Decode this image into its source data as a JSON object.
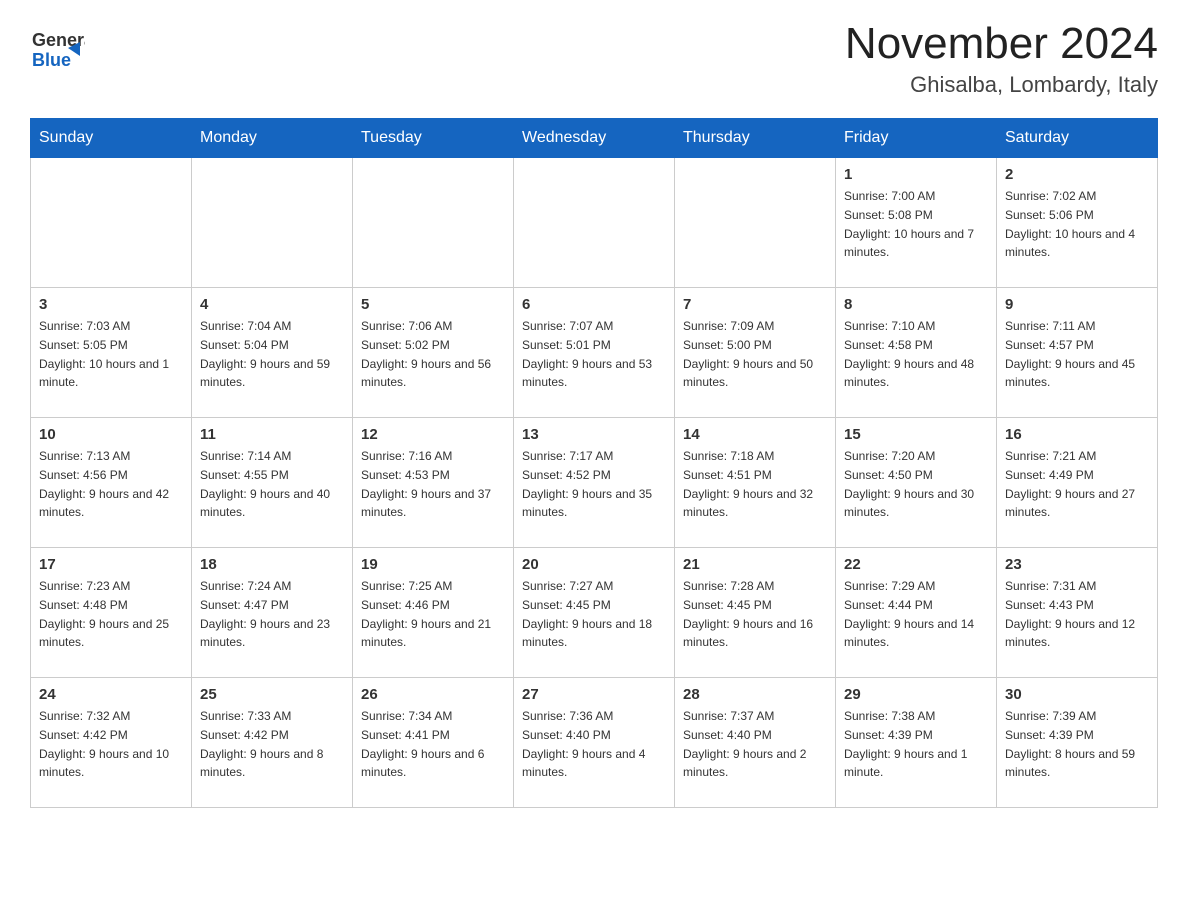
{
  "header": {
    "logo_line1": "General",
    "logo_line2": "Blue",
    "month_title": "November 2024",
    "location": "Ghisalba, Lombardy, Italy"
  },
  "weekdays": [
    "Sunday",
    "Monday",
    "Tuesday",
    "Wednesday",
    "Thursday",
    "Friday",
    "Saturday"
  ],
  "weeks": [
    [
      {
        "day": "",
        "sunrise": "",
        "sunset": "",
        "daylight": ""
      },
      {
        "day": "",
        "sunrise": "",
        "sunset": "",
        "daylight": ""
      },
      {
        "day": "",
        "sunrise": "",
        "sunset": "",
        "daylight": ""
      },
      {
        "day": "",
        "sunrise": "",
        "sunset": "",
        "daylight": ""
      },
      {
        "day": "",
        "sunrise": "",
        "sunset": "",
        "daylight": ""
      },
      {
        "day": "1",
        "sunrise": "Sunrise: 7:00 AM",
        "sunset": "Sunset: 5:08 PM",
        "daylight": "Daylight: 10 hours and 7 minutes."
      },
      {
        "day": "2",
        "sunrise": "Sunrise: 7:02 AM",
        "sunset": "Sunset: 5:06 PM",
        "daylight": "Daylight: 10 hours and 4 minutes."
      }
    ],
    [
      {
        "day": "3",
        "sunrise": "Sunrise: 7:03 AM",
        "sunset": "Sunset: 5:05 PM",
        "daylight": "Daylight: 10 hours and 1 minute."
      },
      {
        "day": "4",
        "sunrise": "Sunrise: 7:04 AM",
        "sunset": "Sunset: 5:04 PM",
        "daylight": "Daylight: 9 hours and 59 minutes."
      },
      {
        "day": "5",
        "sunrise": "Sunrise: 7:06 AM",
        "sunset": "Sunset: 5:02 PM",
        "daylight": "Daylight: 9 hours and 56 minutes."
      },
      {
        "day": "6",
        "sunrise": "Sunrise: 7:07 AM",
        "sunset": "Sunset: 5:01 PM",
        "daylight": "Daylight: 9 hours and 53 minutes."
      },
      {
        "day": "7",
        "sunrise": "Sunrise: 7:09 AM",
        "sunset": "Sunset: 5:00 PM",
        "daylight": "Daylight: 9 hours and 50 minutes."
      },
      {
        "day": "8",
        "sunrise": "Sunrise: 7:10 AM",
        "sunset": "Sunset: 4:58 PM",
        "daylight": "Daylight: 9 hours and 48 minutes."
      },
      {
        "day": "9",
        "sunrise": "Sunrise: 7:11 AM",
        "sunset": "Sunset: 4:57 PM",
        "daylight": "Daylight: 9 hours and 45 minutes."
      }
    ],
    [
      {
        "day": "10",
        "sunrise": "Sunrise: 7:13 AM",
        "sunset": "Sunset: 4:56 PM",
        "daylight": "Daylight: 9 hours and 42 minutes."
      },
      {
        "day": "11",
        "sunrise": "Sunrise: 7:14 AM",
        "sunset": "Sunset: 4:55 PM",
        "daylight": "Daylight: 9 hours and 40 minutes."
      },
      {
        "day": "12",
        "sunrise": "Sunrise: 7:16 AM",
        "sunset": "Sunset: 4:53 PM",
        "daylight": "Daylight: 9 hours and 37 minutes."
      },
      {
        "day": "13",
        "sunrise": "Sunrise: 7:17 AM",
        "sunset": "Sunset: 4:52 PM",
        "daylight": "Daylight: 9 hours and 35 minutes."
      },
      {
        "day": "14",
        "sunrise": "Sunrise: 7:18 AM",
        "sunset": "Sunset: 4:51 PM",
        "daylight": "Daylight: 9 hours and 32 minutes."
      },
      {
        "day": "15",
        "sunrise": "Sunrise: 7:20 AM",
        "sunset": "Sunset: 4:50 PM",
        "daylight": "Daylight: 9 hours and 30 minutes."
      },
      {
        "day": "16",
        "sunrise": "Sunrise: 7:21 AM",
        "sunset": "Sunset: 4:49 PM",
        "daylight": "Daylight: 9 hours and 27 minutes."
      }
    ],
    [
      {
        "day": "17",
        "sunrise": "Sunrise: 7:23 AM",
        "sunset": "Sunset: 4:48 PM",
        "daylight": "Daylight: 9 hours and 25 minutes."
      },
      {
        "day": "18",
        "sunrise": "Sunrise: 7:24 AM",
        "sunset": "Sunset: 4:47 PM",
        "daylight": "Daylight: 9 hours and 23 minutes."
      },
      {
        "day": "19",
        "sunrise": "Sunrise: 7:25 AM",
        "sunset": "Sunset: 4:46 PM",
        "daylight": "Daylight: 9 hours and 21 minutes."
      },
      {
        "day": "20",
        "sunrise": "Sunrise: 7:27 AM",
        "sunset": "Sunset: 4:45 PM",
        "daylight": "Daylight: 9 hours and 18 minutes."
      },
      {
        "day": "21",
        "sunrise": "Sunrise: 7:28 AM",
        "sunset": "Sunset: 4:45 PM",
        "daylight": "Daylight: 9 hours and 16 minutes."
      },
      {
        "day": "22",
        "sunrise": "Sunrise: 7:29 AM",
        "sunset": "Sunset: 4:44 PM",
        "daylight": "Daylight: 9 hours and 14 minutes."
      },
      {
        "day": "23",
        "sunrise": "Sunrise: 7:31 AM",
        "sunset": "Sunset: 4:43 PM",
        "daylight": "Daylight: 9 hours and 12 minutes."
      }
    ],
    [
      {
        "day": "24",
        "sunrise": "Sunrise: 7:32 AM",
        "sunset": "Sunset: 4:42 PM",
        "daylight": "Daylight: 9 hours and 10 minutes."
      },
      {
        "day": "25",
        "sunrise": "Sunrise: 7:33 AM",
        "sunset": "Sunset: 4:42 PM",
        "daylight": "Daylight: 9 hours and 8 minutes."
      },
      {
        "day": "26",
        "sunrise": "Sunrise: 7:34 AM",
        "sunset": "Sunset: 4:41 PM",
        "daylight": "Daylight: 9 hours and 6 minutes."
      },
      {
        "day": "27",
        "sunrise": "Sunrise: 7:36 AM",
        "sunset": "Sunset: 4:40 PM",
        "daylight": "Daylight: 9 hours and 4 minutes."
      },
      {
        "day": "28",
        "sunrise": "Sunrise: 7:37 AM",
        "sunset": "Sunset: 4:40 PM",
        "daylight": "Daylight: 9 hours and 2 minutes."
      },
      {
        "day": "29",
        "sunrise": "Sunrise: 7:38 AM",
        "sunset": "Sunset: 4:39 PM",
        "daylight": "Daylight: 9 hours and 1 minute."
      },
      {
        "day": "30",
        "sunrise": "Sunrise: 7:39 AM",
        "sunset": "Sunset: 4:39 PM",
        "daylight": "Daylight: 8 hours and 59 minutes."
      }
    ]
  ]
}
